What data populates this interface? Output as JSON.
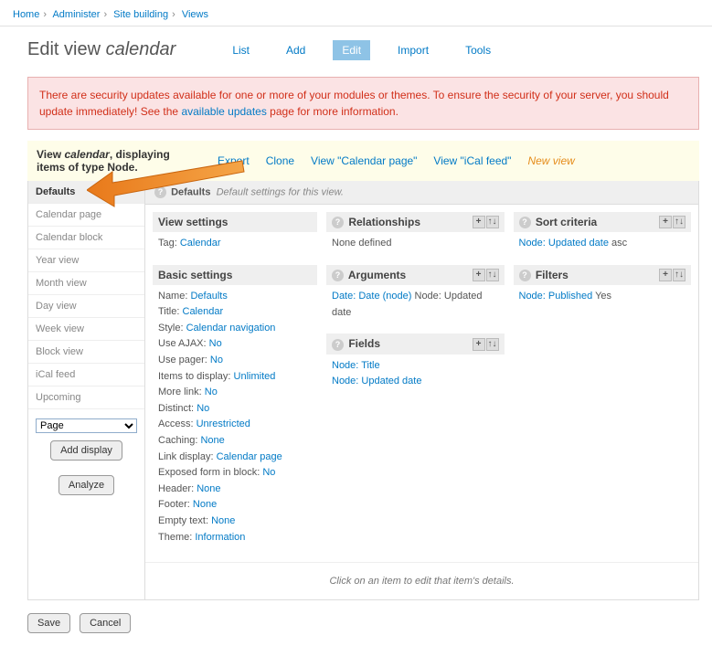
{
  "breadcrumb": [
    "Home",
    "Administer",
    "Site building",
    "Views"
  ],
  "page_title": {
    "prefix": "Edit view ",
    "name": "calendar"
  },
  "tabs": [
    {
      "label": "List",
      "active": false
    },
    {
      "label": "Add",
      "active": false
    },
    {
      "label": "Edit",
      "active": true
    },
    {
      "label": "Import",
      "active": false
    },
    {
      "label": "Tools",
      "active": false
    }
  ],
  "alert": {
    "text1": "There are security updates available for one or more of your modules or themes. To ensure the security of your server, you should update immediately! See the ",
    "link": "available updates",
    "text2": " page for more information."
  },
  "summary": {
    "text1": "View ",
    "name": "calendar",
    "text2": ", displaying items of type ",
    "type": "Node",
    "actions": [
      "Export",
      "Clone",
      "View \"Calendar page\"",
      "View \"iCal feed\""
    ],
    "new_view": "New view"
  },
  "sidebar": {
    "tabs": [
      "Defaults",
      "Calendar page",
      "Calendar block",
      "Year view",
      "Month view",
      "Day view",
      "Week view",
      "Block view",
      "iCal feed",
      "Upcoming"
    ],
    "active_tab": "Defaults",
    "select_value": "Page",
    "add_display": "Add display",
    "analyze": "Analyze"
  },
  "defaults_header": {
    "title": "Defaults",
    "subtitle": "Default settings for this view."
  },
  "panels": {
    "view_settings": {
      "title": "View settings",
      "rows": [
        {
          "label": "Tag:",
          "link": "Calendar"
        }
      ]
    },
    "basic_settings": {
      "title": "Basic settings",
      "rows": [
        {
          "label": "Name:",
          "link": "Defaults"
        },
        {
          "label": "Title:",
          "link": "Calendar"
        },
        {
          "label": "Style:",
          "link": "Calendar navigation"
        },
        {
          "label": "Use AJAX:",
          "link": "No"
        },
        {
          "label": "Use pager:",
          "link": "No"
        },
        {
          "label": "Items to display:",
          "link": "Unlimited"
        },
        {
          "label": "More link:",
          "link": "No"
        },
        {
          "label": "Distinct:",
          "link": "No"
        },
        {
          "label": "Access:",
          "link": "Unrestricted"
        },
        {
          "label": "Caching:",
          "link": "None"
        },
        {
          "label": "Link display:",
          "link": "Calendar page"
        },
        {
          "label": "Exposed form in block:",
          "link": "No"
        },
        {
          "label": "Header:",
          "link": "None"
        },
        {
          "label": "Footer:",
          "link": "None"
        },
        {
          "label": "Empty text:",
          "link": "None"
        },
        {
          "label": "Theme:",
          "link": "Information"
        }
      ]
    },
    "relationships": {
      "title": "Relationships",
      "empty": "None defined"
    },
    "arguments": {
      "title": "Arguments",
      "rows": [
        {
          "link": "Date: Date (node)",
          "suffix": " Node: Updated date"
        }
      ]
    },
    "fields": {
      "title": "Fields",
      "rows": [
        {
          "link": "Node: Title"
        },
        {
          "link": "Node: Updated date"
        }
      ]
    },
    "sort_criteria": {
      "title": "Sort criteria",
      "rows": [
        {
          "link": "Node: Updated date",
          "suffix": " asc"
        }
      ]
    },
    "filters": {
      "title": "Filters",
      "rows": [
        {
          "link": "Node: Published",
          "suffix": " Yes"
        }
      ]
    }
  },
  "click_hint": "Click on an item to edit that item's details.",
  "bottom": {
    "save": "Save",
    "cancel": "Cancel"
  }
}
